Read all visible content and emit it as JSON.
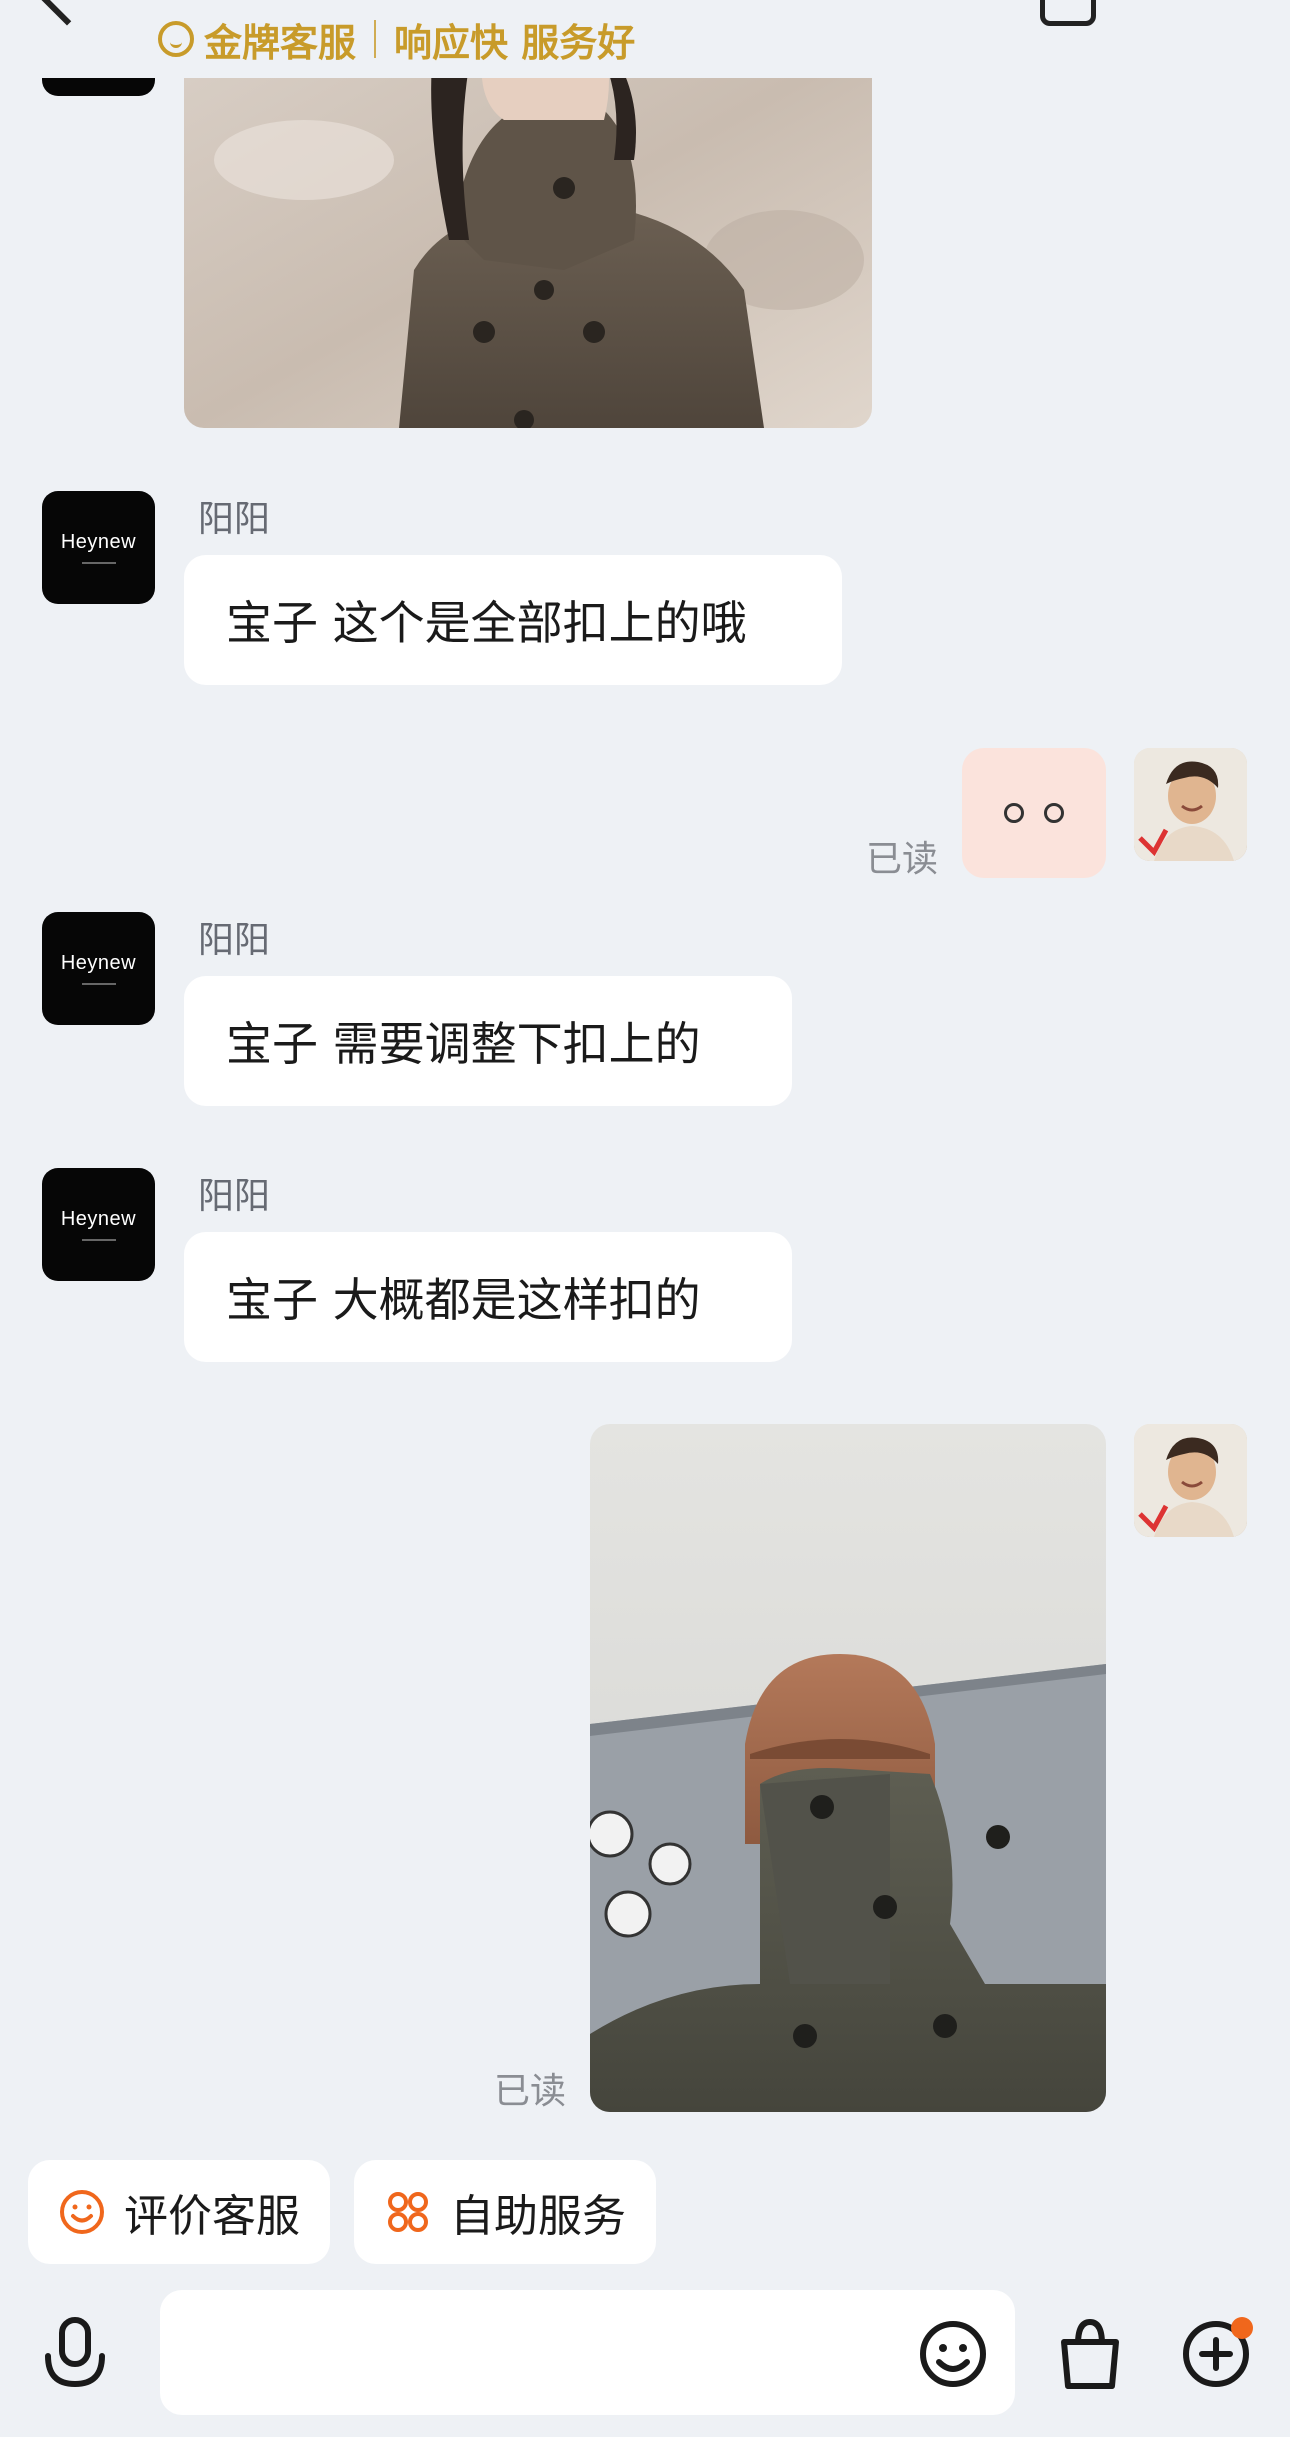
{
  "header": {
    "badge_gold": "金牌客服",
    "badge_tagline": "响应快 服务好"
  },
  "shop": {
    "avatar_brand": "Heynew",
    "agent_name": "阳阳"
  },
  "messages": [
    {
      "side": "left",
      "type": "image",
      "desc": "product photo"
    },
    {
      "side": "left",
      "type": "text",
      "sender": "阳阳",
      "text": "宝子 这个是全部扣上的哦"
    },
    {
      "side": "right",
      "type": "emoji",
      "text": "。。",
      "read_status": "已读"
    },
    {
      "side": "left",
      "type": "text",
      "sender": "阳阳",
      "text": "宝子 需要调整下扣上的"
    },
    {
      "side": "left",
      "type": "text",
      "sender": "阳阳",
      "text": "宝子 大概都是这样扣的"
    },
    {
      "side": "right",
      "type": "image",
      "read_status": "已读"
    }
  ],
  "quick_actions": [
    {
      "label": "评价客服",
      "icon": "smile-circle-icon"
    },
    {
      "label": "自助服务",
      "icon": "four-circles-icon"
    }
  ],
  "input_bar": {
    "icons": [
      "microphone-icon",
      "emoji-icon",
      "shopping-bag-icon",
      "plus-circle-icon"
    ],
    "has_notification_dot": true
  },
  "colors": {
    "background": "#eef1f5",
    "gold": "#c89b2a",
    "accent_orange": "#f0671c",
    "emoji_bubble": "#fbe3dc"
  }
}
